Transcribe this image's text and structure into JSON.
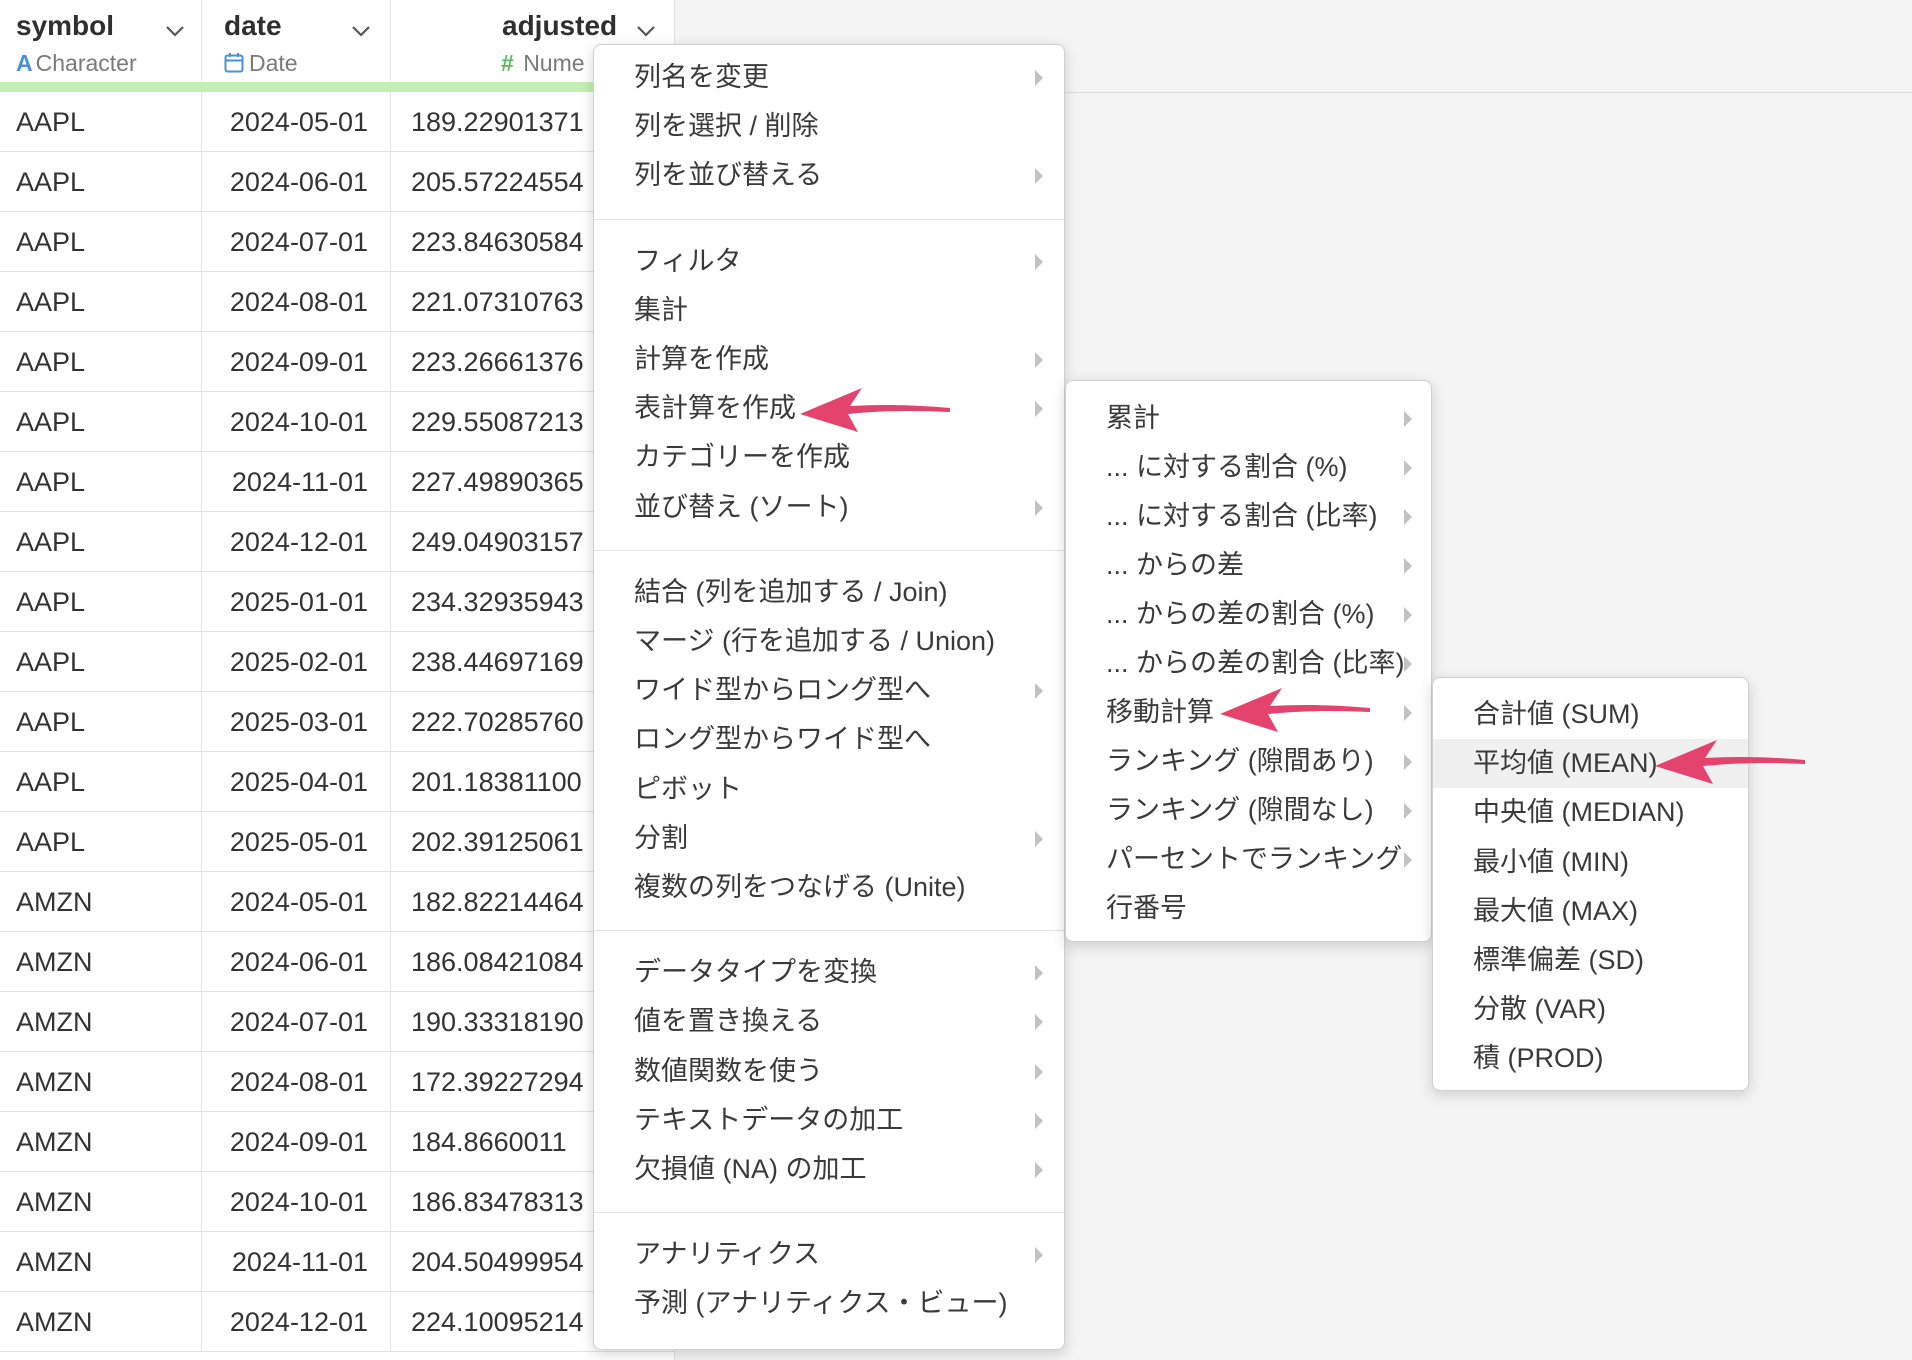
{
  "columns": [
    {
      "name": "symbol",
      "type_icon": "A",
      "type_label": "Character"
    },
    {
      "name": "date",
      "type_icon": "calendar-icon",
      "type_label": "Date"
    },
    {
      "name": "adjusted",
      "type_icon": "#",
      "type_label": "Nume"
    }
  ],
  "rows": [
    {
      "symbol": "AAPL",
      "date": "2024-05-01",
      "adjusted": "189.22901371"
    },
    {
      "symbol": "AAPL",
      "date": "2024-06-01",
      "adjusted": "205.57224554"
    },
    {
      "symbol": "AAPL",
      "date": "2024-07-01",
      "adjusted": "223.84630584"
    },
    {
      "symbol": "AAPL",
      "date": "2024-08-01",
      "adjusted": "221.07310763"
    },
    {
      "symbol": "AAPL",
      "date": "2024-09-01",
      "adjusted": "223.26661376"
    },
    {
      "symbol": "AAPL",
      "date": "2024-10-01",
      "adjusted": "229.55087213"
    },
    {
      "symbol": "AAPL",
      "date": "2024-11-01",
      "adjusted": "227.49890365"
    },
    {
      "symbol": "AAPL",
      "date": "2024-12-01",
      "adjusted": "249.04903157"
    },
    {
      "symbol": "AAPL",
      "date": "2025-01-01",
      "adjusted": "234.32935943"
    },
    {
      "symbol": "AAPL",
      "date": "2025-02-01",
      "adjusted": "238.44697169"
    },
    {
      "symbol": "AAPL",
      "date": "2025-03-01",
      "adjusted": "222.70285760"
    },
    {
      "symbol": "AAPL",
      "date": "2025-04-01",
      "adjusted": "201.18381100"
    },
    {
      "symbol": "AAPL",
      "date": "2025-05-01",
      "adjusted": "202.39125061"
    },
    {
      "symbol": "AMZN",
      "date": "2024-05-01",
      "adjusted": "182.82214464"
    },
    {
      "symbol": "AMZN",
      "date": "2024-06-01",
      "adjusted": "186.08421084"
    },
    {
      "symbol": "AMZN",
      "date": "2024-07-01",
      "adjusted": "190.33318190"
    },
    {
      "symbol": "AMZN",
      "date": "2024-08-01",
      "adjusted": "172.39227294"
    },
    {
      "symbol": "AMZN",
      "date": "2024-09-01",
      "adjusted": "184.8660011"
    },
    {
      "symbol": "AMZN",
      "date": "2024-10-01",
      "adjusted": "186.83478313"
    },
    {
      "symbol": "AMZN",
      "date": "2024-11-01",
      "adjusted": "204.50499954"
    },
    {
      "symbol": "AMZN",
      "date": "2024-12-01",
      "adjusted": "224.10095214"
    }
  ],
  "main_menu": {
    "groups": [
      [
        {
          "label": "列名を変更",
          "submenu": true
        },
        {
          "label": "列を選択 / 削除",
          "submenu": false
        },
        {
          "label": "列を並び替える",
          "submenu": true
        }
      ],
      [
        {
          "label": "フィルタ",
          "submenu": true
        },
        {
          "label": "集計",
          "submenu": false
        },
        {
          "label": "計算を作成",
          "submenu": true
        },
        {
          "label": "表計算を作成",
          "submenu": true
        },
        {
          "label": "カテゴリーを作成",
          "submenu": false
        },
        {
          "label": "並び替え (ソート)",
          "submenu": true
        }
      ],
      [
        {
          "label": "結合 (列を追加する / Join)",
          "submenu": false
        },
        {
          "label": "マージ (行を追加する / Union)",
          "submenu": false
        },
        {
          "label": "ワイド型からロング型へ",
          "submenu": true
        },
        {
          "label": "ロング型からワイド型へ",
          "submenu": false
        },
        {
          "label": "ピボット",
          "submenu": false
        },
        {
          "label": "分割",
          "submenu": true
        },
        {
          "label": "複数の列をつなげる (Unite)",
          "submenu": false
        }
      ],
      [
        {
          "label": "データタイプを変換",
          "submenu": true
        },
        {
          "label": "値を置き換える",
          "submenu": true
        },
        {
          "label": "数値関数を使う",
          "submenu": true
        },
        {
          "label": "テキストデータの加工",
          "submenu": true
        },
        {
          "label": "欠損値 (NA) の加工",
          "submenu": true
        }
      ],
      [
        {
          "label": "アナリティクス",
          "submenu": true
        },
        {
          "label": "予測 (アナリティクス・ビュー)",
          "submenu": false
        }
      ]
    ]
  },
  "table_calc_menu": {
    "items": [
      {
        "label": "累計",
        "submenu": true
      },
      {
        "label": "... に対する割合 (%)",
        "submenu": true
      },
      {
        "label": "... に対する割合 (比率)",
        "submenu": true
      },
      {
        "label": "... からの差",
        "submenu": true
      },
      {
        "label": "... からの差の割合 (%)",
        "submenu": true
      },
      {
        "label": "... からの差の割合 (比率)",
        "submenu": true
      },
      {
        "label": "移動計算",
        "submenu": true
      },
      {
        "label": "ランキング (隙間あり)",
        "submenu": true
      },
      {
        "label": "ランキング (隙間なし)",
        "submenu": true
      },
      {
        "label": "パーセントでランキング",
        "submenu": true
      },
      {
        "label": "行番号",
        "submenu": false
      }
    ]
  },
  "moving_calc_menu": {
    "items": [
      {
        "label": "合計値 (SUM)"
      },
      {
        "label": "平均値 (MEAN)"
      },
      {
        "label": "中央値 (MEDIAN)"
      },
      {
        "label": "最小値 (MIN)"
      },
      {
        "label": "最大値 (MAX)"
      },
      {
        "label": "標準偏差 (SD)"
      },
      {
        "label": "分散 (VAR)"
      },
      {
        "label": "積 (PROD)"
      }
    ],
    "highlighted": "平均値 (MEAN)"
  },
  "colors": {
    "pointer": "#e4436e",
    "character_icon": "#4a90d9",
    "date_icon": "#4a90d9",
    "numeric_icon": "#5cb85c",
    "header_green": "#c5efb2"
  }
}
